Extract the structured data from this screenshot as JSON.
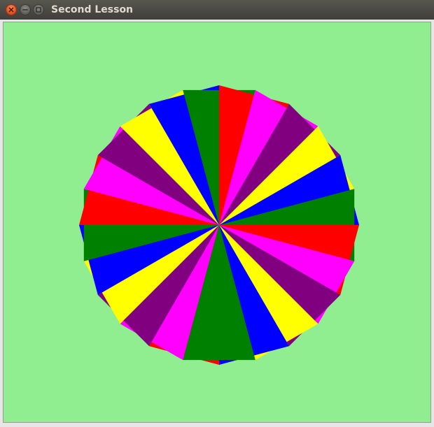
{
  "window": {
    "title": "Second Lesson",
    "buttons": [
      "close-icon",
      "minimize-icon",
      "maximize-icon"
    ]
  },
  "canvas": {
    "background": "#90ee90",
    "palette": [
      "#ff0000",
      "#008000",
      "#0000ff",
      "#ffff00",
      "#800080",
      "#ff00ff"
    ],
    "wedge_colors_counterclockwise_from_bottom": [
      "#ff0000",
      "#ff00ff",
      "#800080",
      "#ffff00",
      "#0000ff",
      "#008000",
      "#ff0000",
      "#ff00ff",
      "#800080",
      "#ffff00",
      "#0000ff",
      "#008000",
      "#ff0000",
      "#ff00ff",
      "#800080",
      "#ffff00",
      "#0000ff",
      "#008000",
      "#ff0000",
      "#ff00ff",
      "#800080",
      "#ffff00",
      "#0000ff",
      "#008000"
    ]
  }
}
